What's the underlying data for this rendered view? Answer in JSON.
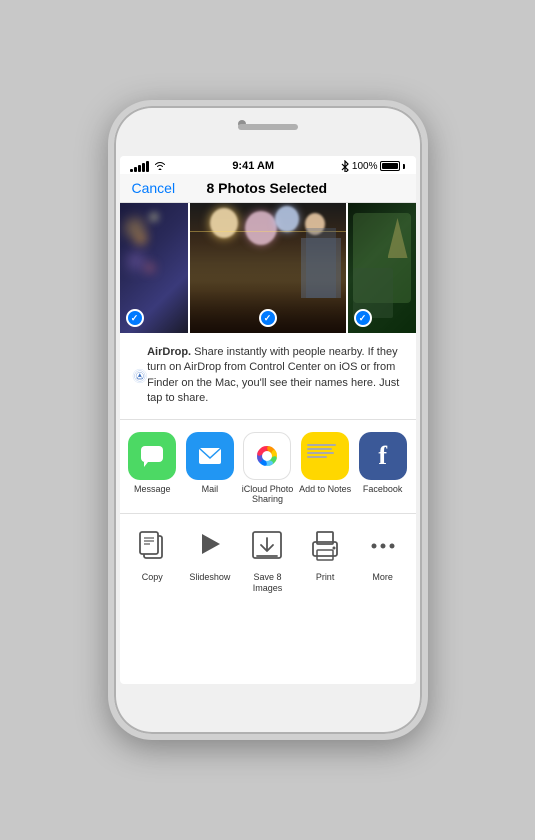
{
  "phone": {
    "status_bar": {
      "time": "9:41 AM",
      "battery_percent": "100%",
      "bluetooth": "bluetooth"
    },
    "nav": {
      "cancel_label": "Cancel",
      "title": "8 Photos Selected"
    },
    "airdrop": {
      "name": "AirDrop.",
      "description": " Share instantly with people nearby. If they turn on AirDrop from Control Center on iOS or from Finder on the Mac, you'll see their names here. Just tap to share."
    },
    "apps": [
      {
        "id": "message",
        "label": "Message"
      },
      {
        "id": "mail",
        "label": "Mail"
      },
      {
        "id": "icloud-photos",
        "label": "iCloud Photo Sharing"
      },
      {
        "id": "notes",
        "label": "Add to Notes"
      },
      {
        "id": "facebook",
        "label": "Facebook"
      }
    ],
    "actions": [
      {
        "id": "copy",
        "label": "Copy"
      },
      {
        "id": "slideshow",
        "label": "Slideshow"
      },
      {
        "id": "save",
        "label": "Save 8 Images"
      },
      {
        "id": "print",
        "label": "Print"
      },
      {
        "id": "more",
        "label": "More"
      }
    ]
  }
}
